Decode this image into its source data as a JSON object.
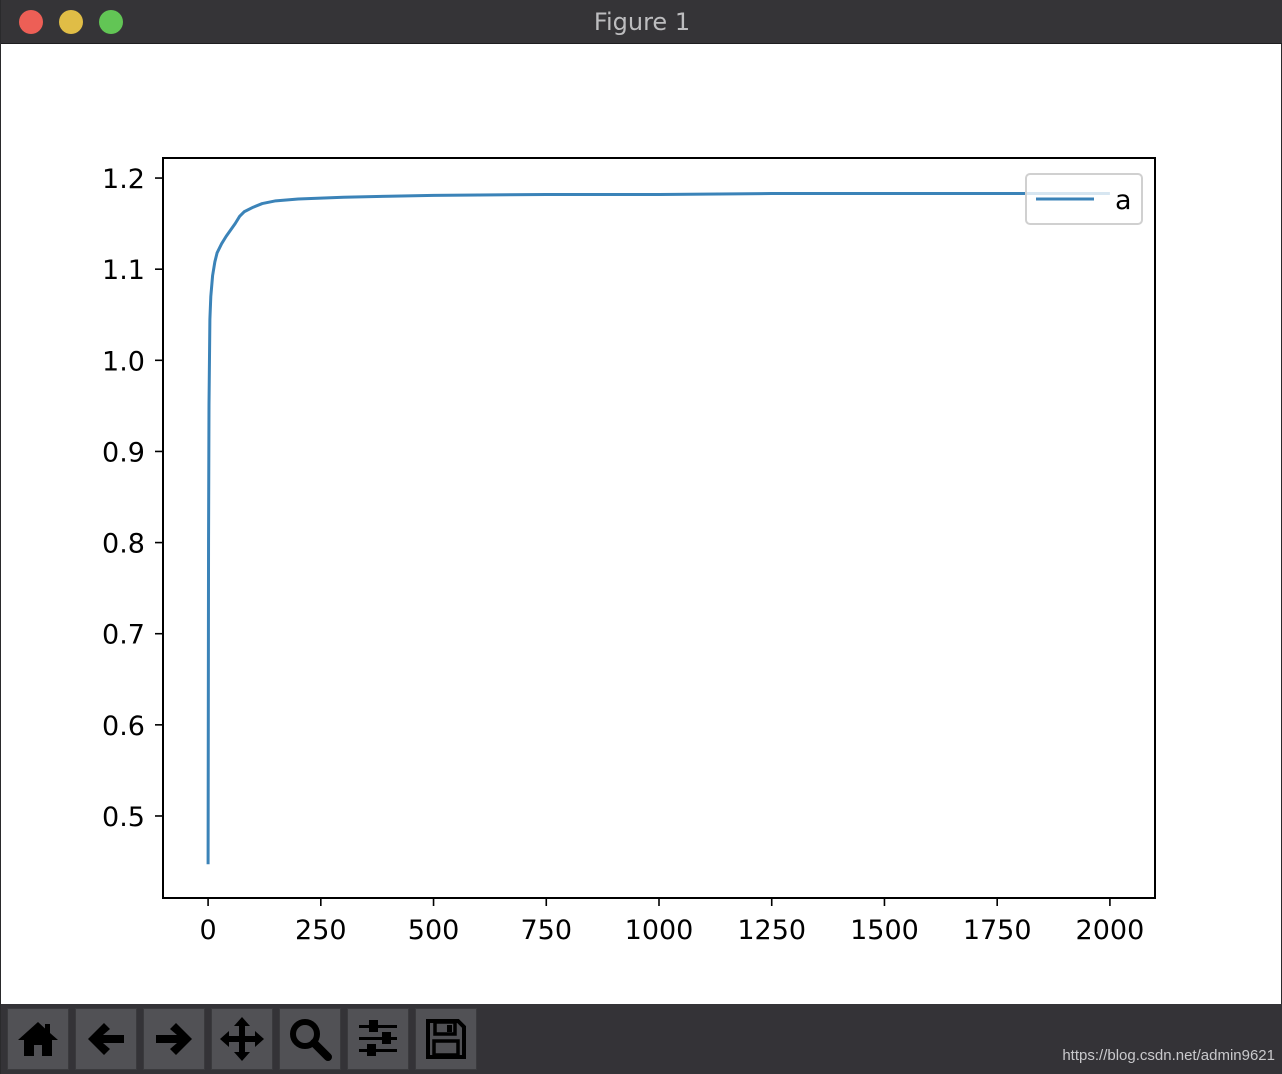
{
  "window": {
    "title": "Figure 1"
  },
  "toolbar": {
    "buttons": [
      {
        "name": "home-button",
        "icon": "home-icon"
      },
      {
        "name": "back-button",
        "icon": "arrow-left-icon"
      },
      {
        "name": "forward-button",
        "icon": "arrow-right-icon"
      },
      {
        "name": "pan-button",
        "icon": "move-icon"
      },
      {
        "name": "zoom-button",
        "icon": "magnifier-icon"
      },
      {
        "name": "configure-subplots-button",
        "icon": "sliders-icon"
      },
      {
        "name": "save-button",
        "icon": "floppy-disk-icon"
      }
    ]
  },
  "watermark": "https://blog.csdn.net/admin9621",
  "chart_data": {
    "type": "line",
    "xlim": [
      -100,
      2100
    ],
    "ylim": [
      0.41,
      1.222
    ],
    "xticks": [
      0,
      250,
      500,
      750,
      1000,
      1250,
      1500,
      1750,
      2000
    ],
    "xtick_labels": [
      "0",
      "250",
      "500",
      "750",
      "1000",
      "1250",
      "1500",
      "1750",
      "2000"
    ],
    "yticks": [
      0.5,
      0.6,
      0.7,
      0.8,
      0.9,
      1.0,
      1.1,
      1.2
    ],
    "ytick_labels": [
      "0.5",
      "0.6",
      "0.7",
      "0.8",
      "0.9",
      "1.0",
      "1.1",
      "1.2"
    ],
    "legend_position": "top-right",
    "grid": false,
    "series": [
      {
        "name": "a",
        "color": "#3b83b8",
        "x": [
          0,
          1,
          2,
          4,
          6,
          10,
          15,
          20,
          30,
          40,
          50,
          60,
          70,
          80,
          100,
          120,
          150,
          200,
          250,
          300,
          400,
          500,
          750,
          1000,
          1250,
          1500,
          1750,
          2000
        ],
        "y": [
          0.447,
          0.8,
          0.95,
          1.045,
          1.07,
          1.093,
          1.108,
          1.118,
          1.128,
          1.136,
          1.143,
          1.15,
          1.158,
          1.163,
          1.168,
          1.172,
          1.175,
          1.177,
          1.178,
          1.179,
          1.18,
          1.181,
          1.182,
          1.182,
          1.183,
          1.183,
          1.183,
          1.183
        ]
      }
    ]
  }
}
